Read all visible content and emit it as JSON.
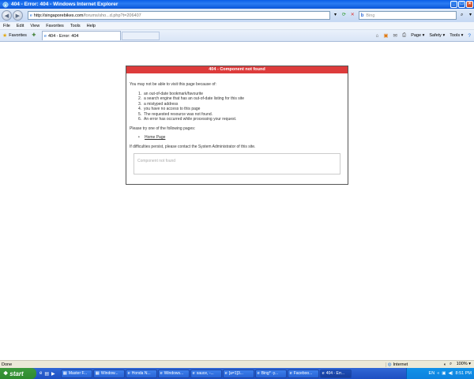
{
  "window": {
    "title": "404 - Error: 404 - Windows Internet Explorer"
  },
  "address_bar": {
    "url_host": "http://singaporebikes.com",
    "url_path": "/forums/sho...d.php?t=206407",
    "search_placeholder": "Bing"
  },
  "menu": {
    "items": [
      "File",
      "Edit",
      "View",
      "Favorites",
      "Tools",
      "Help"
    ]
  },
  "favorites_bar": {
    "favorites_label": "Favorites",
    "active_tab_label": "404 - Error: 404"
  },
  "command_bar": {
    "page_label": "Page",
    "safety_label": "Safety",
    "tools_label": "Tools"
  },
  "error_page": {
    "header": "404 - Component not found",
    "intro": "You may not be able to visit this page because of:",
    "reasons": [
      {
        "n": "1.",
        "text": "an out-of-date bookmark/favourite"
      },
      {
        "n": "2.",
        "text": "a search engine that has an out-of-date listing for this site"
      },
      {
        "n": "3.",
        "text": "a mistyped address"
      },
      {
        "n": "4.",
        "text": "you have no access to this page"
      },
      {
        "n": "5.",
        "text": "The requested resource was not found."
      },
      {
        "n": "6.",
        "text": "An error has occurred while processing your request."
      }
    ],
    "try_text": "Please try one of the following pages:",
    "home_link": "Home Page",
    "contact_text": "If difficulties persist, please contact the System Administrator of this site.",
    "component_message": "Component not found"
  },
  "status_bar": {
    "status_text": "Done",
    "zone_label": "Internet",
    "zoom": "100%"
  },
  "taskbar": {
    "start_label": "start",
    "tasks": [
      {
        "label": "Master F...",
        "active": false
      },
      {
        "label": "Window...",
        "active": false
      },
      {
        "label": "Honda N...",
        "active": false
      },
      {
        "label": "Windows...",
        "active": false
      },
      {
        "label": "sauce, -...",
        "active": false
      },
      {
        "label": "[a=1]3...",
        "active": false
      },
      {
        "label": "Bing* -y...",
        "active": false
      },
      {
        "label": "Faceboo...",
        "active": false
      },
      {
        "label": "404 - Err...",
        "active": true
      }
    ],
    "language": "EN",
    "clock": "8:51 PM"
  }
}
